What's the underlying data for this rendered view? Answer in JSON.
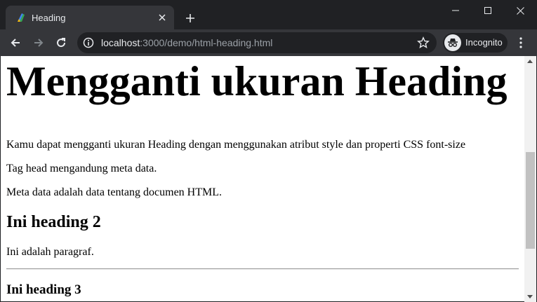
{
  "browser": {
    "tab": {
      "title": "Heading",
      "close_icon": "close-icon",
      "favicon": "app-favicon"
    },
    "window_controls": [
      "minimize-icon",
      "maximize-icon",
      "close-icon"
    ],
    "toolbar": {
      "url_host": "localhost",
      "url_path": ":3000/demo/html-heading.html",
      "incognito_label": "Incognito"
    }
  },
  "page": {
    "h1": "Mengganti ukuran Heading",
    "paragraphs": [
      "Kamu dapat mengganti ukuran Heading dengan menggunakan atribut style dan properti CSS font-size",
      "Tag head mengandung meta data.",
      "Meta data adalah data tentang documen HTML."
    ],
    "h2": "Ini heading 2",
    "paragraph_after_h2": "Ini adalah paragraf.",
    "h3": "Ini heading 3"
  },
  "colors": {
    "chrome_dark": "#202124",
    "chrome_toolbar": "#35363a",
    "text_light": "#e8eaed",
    "url_path": "#9aa0a6"
  }
}
